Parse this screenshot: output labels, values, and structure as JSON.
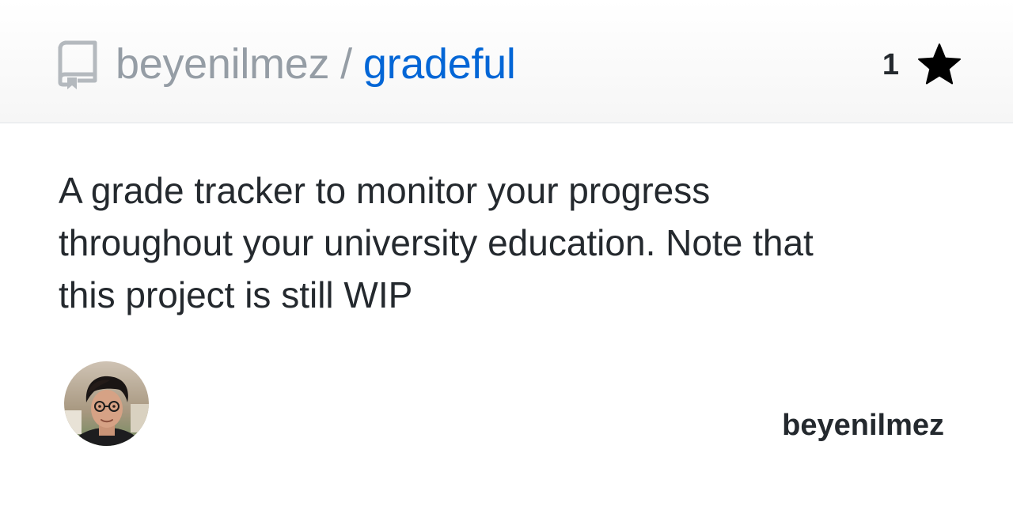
{
  "header": {
    "owner": "beyenilmez",
    "separator": "/",
    "repo": "gradeful",
    "repo_icon": "repo-book-icon",
    "star_count": "1",
    "star_icon": "star-icon"
  },
  "description": "A grade tracker to monitor your progress throughout your university education. Note that this project is still WIP",
  "footer": {
    "avatar_icon": "user-avatar",
    "username": "beyenilmez"
  },
  "colors": {
    "link": "#0366d6",
    "muted": "#959da5",
    "text": "#24292e"
  }
}
